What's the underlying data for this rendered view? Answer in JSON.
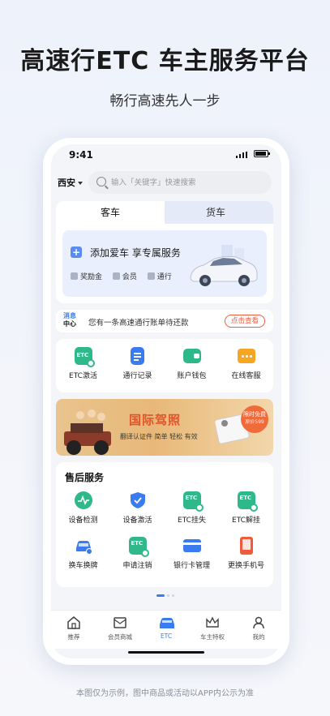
{
  "hero": {
    "title": "高速行ETC  车主服务平台",
    "subtitle": "畅行高速先人一步"
  },
  "status": {
    "time": "9:41"
  },
  "topbar": {
    "city": "西安",
    "search_placeholder": "输入「关键字」快速搜索"
  },
  "vehicle_tabs": {
    "active": "客车",
    "inactive": "货车"
  },
  "add_car": {
    "title": "添加爱车  享专属服务",
    "perks": [
      {
        "label": "奖励金"
      },
      {
        "label": "会员"
      },
      {
        "label": "通行"
      }
    ]
  },
  "message": {
    "tag_line1": "消息",
    "tag_line2": "中心",
    "text": "您有一条高速通行账单待还款",
    "button": "点击查看"
  },
  "quick_actions": [
    {
      "label": "ETC激活",
      "icon": "etc-activate-icon",
      "color": "#2fb98a"
    },
    {
      "label": "通行记录",
      "icon": "document-icon",
      "color": "#3a7bef"
    },
    {
      "label": "账户钱包",
      "icon": "wallet-icon",
      "color": "#2fb98a"
    },
    {
      "label": "在线客服",
      "icon": "chat-icon",
      "color": "#f5a623"
    }
  ],
  "banner": {
    "title": "国际驾照",
    "subtitle": "翻译认证件  简单 轻松 有效",
    "badge_line1": "限时免费",
    "badge_line2": "原价599"
  },
  "after_sales": {
    "title": "售后服务",
    "items": [
      {
        "label": "设备检测",
        "icon": "device-check-icon",
        "color": "#2fb98a"
      },
      {
        "label": "设备激活",
        "icon": "shield-check-icon",
        "color": "#3a7bef"
      },
      {
        "label": "ETC挂失",
        "icon": "etc-report-loss-icon",
        "color": "#2fb98a"
      },
      {
        "label": "ETC解挂",
        "icon": "etc-unlock-icon",
        "color": "#2fb98a"
      },
      {
        "label": "换车换牌",
        "icon": "car-change-icon",
        "color": "#3a7bef"
      },
      {
        "label": "申请注销",
        "icon": "etc-cancel-icon",
        "color": "#2fb98a"
      },
      {
        "label": "银行卡管理",
        "icon": "bank-card-icon",
        "color": "#3a7bef"
      },
      {
        "label": "更换手机号",
        "icon": "phone-change-icon",
        "color": "#f05a3c"
      }
    ]
  },
  "tabbar": [
    {
      "label": "推荐",
      "icon": "home-icon"
    },
    {
      "label": "会员商城",
      "icon": "mail-icon"
    },
    {
      "label": "ETC",
      "icon": "etc-car-icon",
      "active": true
    },
    {
      "label": "车主特权",
      "icon": "crown-icon"
    },
    {
      "label": "我的",
      "icon": "user-icon"
    }
  ],
  "footnote": "本图仅为示例，图中商品或活动以APP内公示为准"
}
